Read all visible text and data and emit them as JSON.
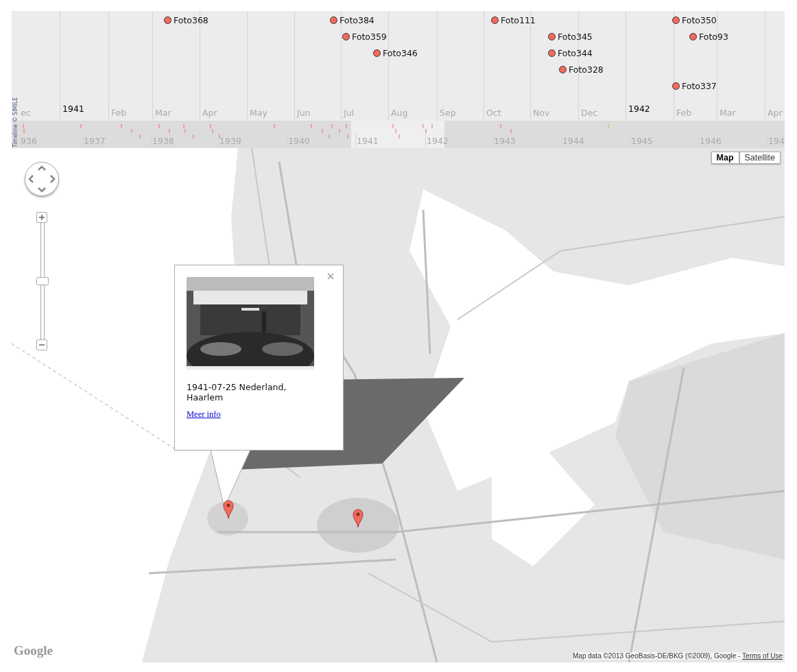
{
  "timeline": {
    "events": [
      {
        "label": "Foto368"
      },
      {
        "label": "Foto384"
      },
      {
        "label": "Foto359"
      },
      {
        "label": "Foto346"
      },
      {
        "label": "Foto111"
      },
      {
        "label": "Foto345"
      },
      {
        "label": "Foto344"
      },
      {
        "label": "Foto328"
      },
      {
        "label": "Foto350"
      },
      {
        "label": "Foto93"
      },
      {
        "label": "Foto337"
      }
    ],
    "scale_labels": [
      {
        "kind": "month",
        "text": "ec"
      },
      {
        "kind": "year",
        "text": "1941"
      },
      {
        "kind": "month",
        "text": "Feb"
      },
      {
        "kind": "month",
        "text": "Mar"
      },
      {
        "kind": "month",
        "text": "Apr"
      },
      {
        "kind": "month",
        "text": "May"
      },
      {
        "kind": "month",
        "text": "Jun"
      },
      {
        "kind": "month",
        "text": "Jul"
      },
      {
        "kind": "month",
        "text": "Aug"
      },
      {
        "kind": "month",
        "text": "Sep"
      },
      {
        "kind": "month",
        "text": "Oct"
      },
      {
        "kind": "month",
        "text": "Nov"
      },
      {
        "kind": "month",
        "text": "Dec"
      },
      {
        "kind": "year",
        "text": "1942"
      },
      {
        "kind": "month",
        "text": "Feb"
      },
      {
        "kind": "month",
        "text": "Mar"
      },
      {
        "kind": "month",
        "text": "Apr"
      }
    ],
    "overview_labels": [
      "936",
      "1937",
      "1938",
      "1939",
      "1940",
      "1941",
      "1942",
      "1943",
      "1944",
      "1945",
      "1946",
      "194"
    ],
    "credit": "Timeline © SIMILE"
  },
  "map": {
    "zoom": {
      "level": 0.5
    },
    "map_types": [
      {
        "label": "Map",
        "selected": true
      },
      {
        "label": "Satellite",
        "selected": false
      }
    ],
    "info_window": {
      "caption": "1941-07-25 Nederland, Haarlem",
      "link": "Meer info"
    },
    "logo": "Google",
    "attribution": "Map data ©2013 GeoBasis-DE/BKG (©2009), Google - ",
    "terms_link": "Terms of Use"
  }
}
